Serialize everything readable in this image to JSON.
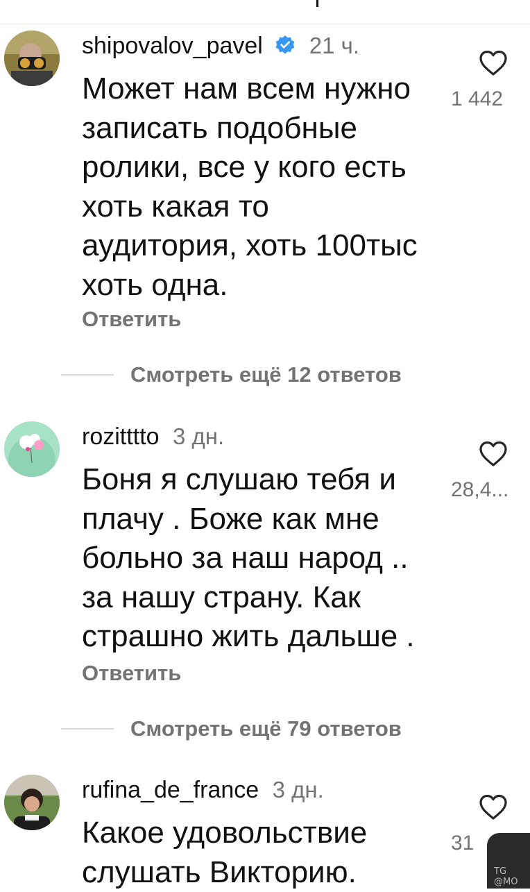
{
  "colors": {
    "text": "#111111",
    "secondary": "#737373",
    "verified": "#3897f0",
    "divider": "#dbdbdb"
  },
  "comments": [
    {
      "username": "shipovalov_pavel",
      "verified": true,
      "time": "21 ч.",
      "text": "Может нам всем нужно\nзаписать подобные\nролики, все у кого есть\nхоть какая то\nаудитория, хоть 100тыс\nхоть одна.",
      "reply_label": "Ответить",
      "likes": "1 442",
      "heart_icon": "heart-outline-icon",
      "view_replies_label": "Смотреть ещё 12 ответов"
    },
    {
      "username": "rozitttto",
      "verified": false,
      "time": "3 дн.",
      "text": "Боня я слушаю тебя  и\nплачу . Боже как мне\nбольно за наш народ ..\nза нашу страну. Как\nстрашно жить дальше .",
      "reply_label": "Ответить",
      "likes": "28,4...",
      "heart_icon": "heart-outline-icon",
      "view_replies_label": "Смотреть ещё 79 ответов"
    },
    {
      "username": "rufina_de_france",
      "verified": false,
      "time": "3 дн.",
      "text": "Какое удовольствие\nслушать Викторию.",
      "likes": "31",
      "heart_icon": "heart-outline-icon"
    }
  ],
  "thumbnail": {
    "tag": "TG @MO"
  }
}
